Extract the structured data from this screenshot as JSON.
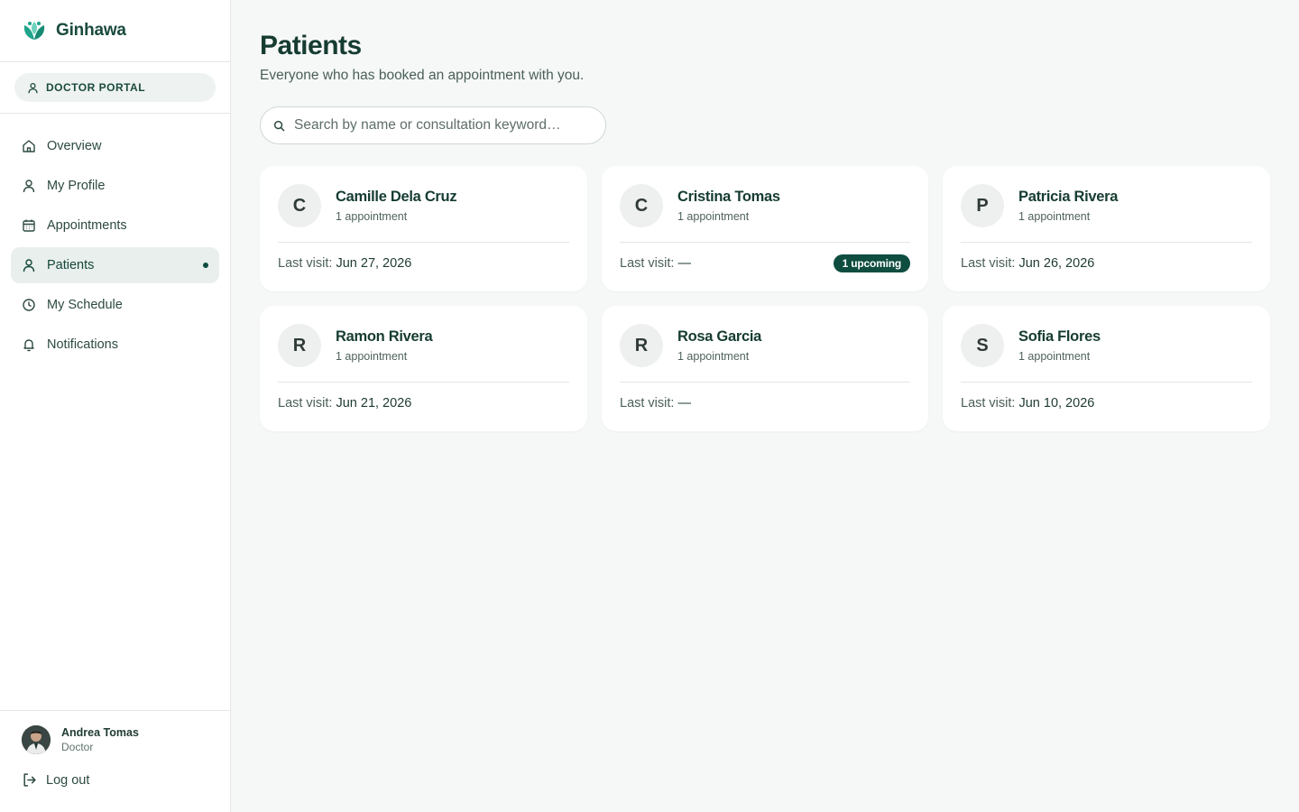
{
  "brand": {
    "name": "Ginhawa"
  },
  "portal": {
    "label": "DOCTOR PORTAL"
  },
  "nav": [
    {
      "label": "Overview",
      "icon": "home-icon",
      "active": false
    },
    {
      "label": "My Profile",
      "icon": "user-icon",
      "active": false
    },
    {
      "label": "Appointments",
      "icon": "calendar-icon",
      "active": false
    },
    {
      "label": "Patients",
      "icon": "user-icon",
      "active": true
    },
    {
      "label": "My Schedule",
      "icon": "clock-icon",
      "active": false
    },
    {
      "label": "Notifications",
      "icon": "bell-icon",
      "active": false
    }
  ],
  "user": {
    "name": "Andrea Tomas",
    "role": "Doctor",
    "logout_label": "Log out"
  },
  "page": {
    "title": "Patients",
    "subtitle": "Everyone who has booked an appointment with you."
  },
  "search": {
    "placeholder": "Search by name or consultation keyword…",
    "value": ""
  },
  "patients": [
    {
      "initial": "C",
      "name": "Camille Dela Cruz",
      "count": "1 appointment",
      "last_visit_label": "Last visit:",
      "last_visit": "Jun 27, 2026",
      "badge": ""
    },
    {
      "initial": "C",
      "name": "Cristina Tomas",
      "count": "1 appointment",
      "last_visit_label": "Last visit:",
      "last_visit": "—",
      "badge": "1 upcoming"
    },
    {
      "initial": "P",
      "name": "Patricia Rivera",
      "count": "1 appointment",
      "last_visit_label": "Last visit:",
      "last_visit": "Jun 26, 2026",
      "badge": ""
    },
    {
      "initial": "R",
      "name": "Ramon Rivera",
      "count": "1 appointment",
      "last_visit_label": "Last visit:",
      "last_visit": "Jun 21, 2026",
      "badge": ""
    },
    {
      "initial": "R",
      "name": "Rosa Garcia",
      "count": "1 appointment",
      "last_visit_label": "Last visit:",
      "last_visit": "—",
      "badge": ""
    },
    {
      "initial": "S",
      "name": "Sofia Flores",
      "count": "1 appointment",
      "last_visit_label": "Last visit:",
      "last_visit": "Jun 10, 2026",
      "badge": ""
    }
  ],
  "colors": {
    "accent": "#0e4d3f",
    "brand_teal": "#1fa58c",
    "background": "#f6f8f7"
  }
}
